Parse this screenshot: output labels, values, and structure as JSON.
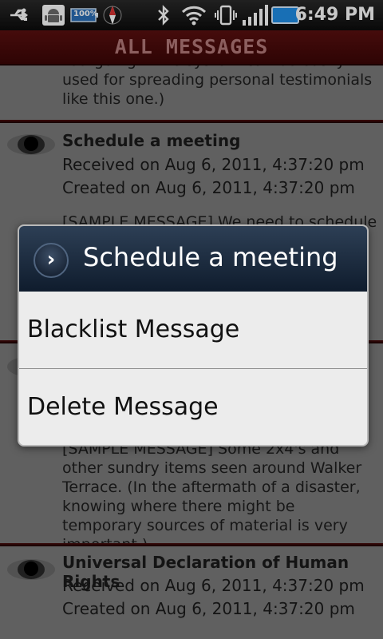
{
  "status_bar": {
    "time": "6:49 PM",
    "battery_small_label": "100%",
    "icons": [
      "usb-icon",
      "android-debug-icon",
      "battery-small-icon",
      "compass-icon",
      "bluetooth-icon",
      "wifi-icon",
      "vibrate-icon",
      "signal-icon",
      "battery-icon"
    ]
  },
  "header": {
    "title": "ALL MESSAGES"
  },
  "messages": [
    {
      "body": "\"outgoing\". The system can be easily used for spreading personal testimonials like this one.)"
    },
    {
      "title": "Schedule a meeting",
      "received": "Received on Aug 6, 2011, 4:37:20 pm",
      "created": "Created on Aug 6, 2011, 4:37:20 pm",
      "body": "[SAMPLE MESSAGE] We need to schedule"
    },
    {
      "body": "[SAMPLE MESSAGE] Some 2x4's and other sundry items seen around Walker Terrace. (In the aftermath of a disaster, knowing where there might be temporary sources of material is very important.)"
    },
    {
      "title": "Universal Declaration of Human Rights",
      "received": "Received on Aug 6, 2011, 4:37:20 pm",
      "created": "Created on Aug 6, 2011, 4:37:20 pm"
    }
  ],
  "dialog": {
    "title": "Schedule a meeting",
    "options": [
      "Blacklist Message",
      "Delete Message"
    ]
  }
}
